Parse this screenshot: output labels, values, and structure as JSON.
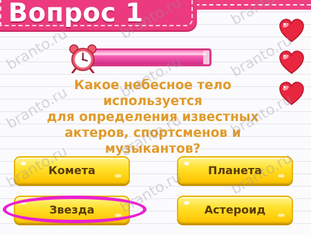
{
  "header": {
    "title": "Вопрос 1"
  },
  "lives": {
    "hearts": [
      "heart-icon",
      "heart-icon",
      "heart-icon"
    ]
  },
  "timer": {
    "icon": "alarm-clock-icon",
    "remaining_fraction": 0.95
  },
  "question": {
    "lines": [
      "Какое небесное тело используется",
      "для определения известных",
      "актеров, спортсменов и",
      "музыкантов?"
    ]
  },
  "answers": [
    {
      "label": "Комета"
    },
    {
      "label": "Планета"
    },
    {
      "label": "Звезда",
      "selected": true
    },
    {
      "label": "Астероид"
    }
  ],
  "watermark": "branto.ru",
  "colors": {
    "banner": "#ec3a7e",
    "timer_fill": "#f050a8",
    "question_text": "#e19a2a",
    "answer_button": "#ffe02a",
    "selection_ring": "#ea1fd3",
    "heart": "#e8263f"
  }
}
